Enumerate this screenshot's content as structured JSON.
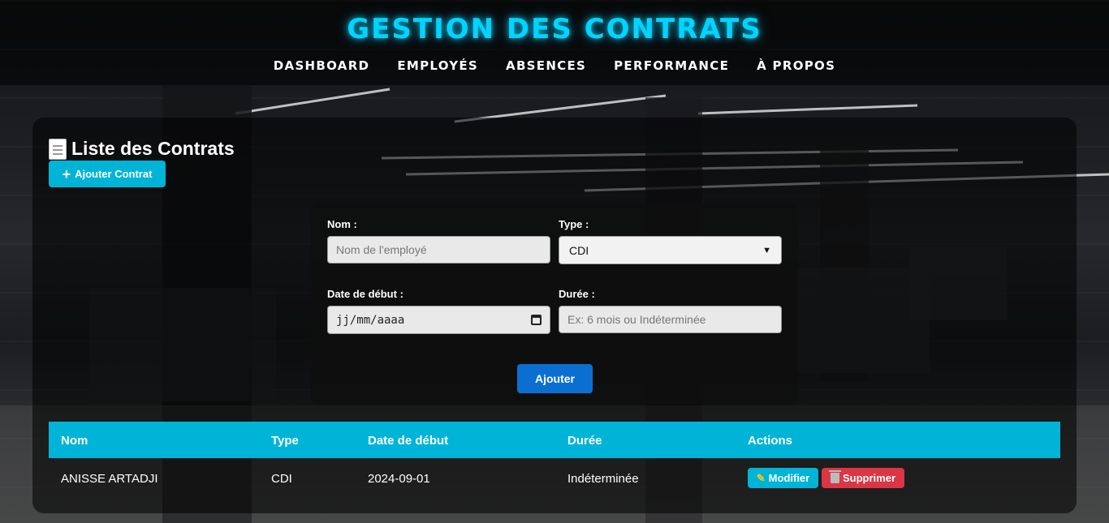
{
  "header": {
    "title": "GESTION DES CONTRATS",
    "nav": [
      "DASHBOARD",
      "EMPLOYÉS",
      "ABSENCES",
      "PERFORMANCE",
      "À PROPOS"
    ]
  },
  "main": {
    "title": "Liste des Contrats",
    "add_button": "Ajouter Contrat"
  },
  "form": {
    "name_label": "Nom :",
    "name_placeholder": "Nom de l'employé",
    "type_label": "Type :",
    "type_selected": "CDI",
    "start_label": "Date de début :",
    "start_value": "jj/mm/aaaa",
    "duration_label": "Durée :",
    "duration_placeholder": "Ex: 6 mois ou Indéterminée",
    "submit": "Ajouter"
  },
  "table": {
    "headers": [
      "Nom",
      "Type",
      "Date de début",
      "Durée",
      "Actions"
    ],
    "rows": [
      {
        "nom": "ANISSE ARTADJI",
        "type": "CDI",
        "date": "2024-09-01",
        "duree": "Indéterminée",
        "edit": "Modifier",
        "delete": "Supprimer"
      }
    ]
  },
  "colors": {
    "accent": "#00b4d8",
    "title_glow": "#00d4ff",
    "submit": "#0b6fd1",
    "danger": "#dc3545"
  }
}
